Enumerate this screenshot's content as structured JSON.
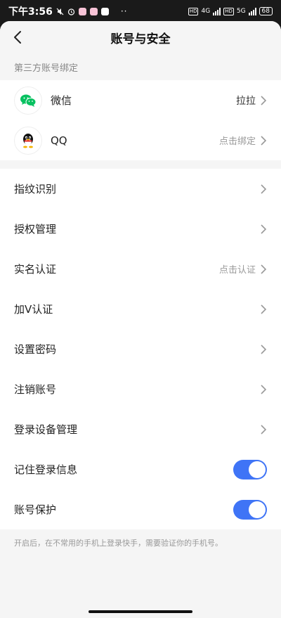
{
  "status_bar": {
    "time": "下午3:56",
    "dots": "··",
    "battery": "68",
    "network_1": "4G",
    "network_2": "5G"
  },
  "nav": {
    "title": "账号与安全"
  },
  "third_party": {
    "section_label": "第三方账号绑定",
    "items": [
      {
        "label": "微信",
        "value": "拉拉",
        "icon": "wechat-icon"
      },
      {
        "label": "QQ",
        "value": "点击绑定",
        "icon": "qq-icon"
      }
    ]
  },
  "settings": {
    "items": [
      {
        "label": "指纹识别",
        "value": ""
      },
      {
        "label": "授权管理",
        "value": ""
      },
      {
        "label": "实名认证",
        "value": "点击认证"
      },
      {
        "label": "加V认证",
        "value": ""
      },
      {
        "label": "设置密码",
        "value": ""
      },
      {
        "label": "注销账号",
        "value": ""
      },
      {
        "label": "登录设备管理",
        "value": ""
      }
    ],
    "toggles": [
      {
        "label": "记住登录信息",
        "on": true
      },
      {
        "label": "账号保护",
        "on": true
      }
    ],
    "footnote": "开启后，在不常用的手机上登录快手，需要验证你的手机号。"
  },
  "colors": {
    "accent": "#3f74f6",
    "wechat": "#07c160"
  }
}
